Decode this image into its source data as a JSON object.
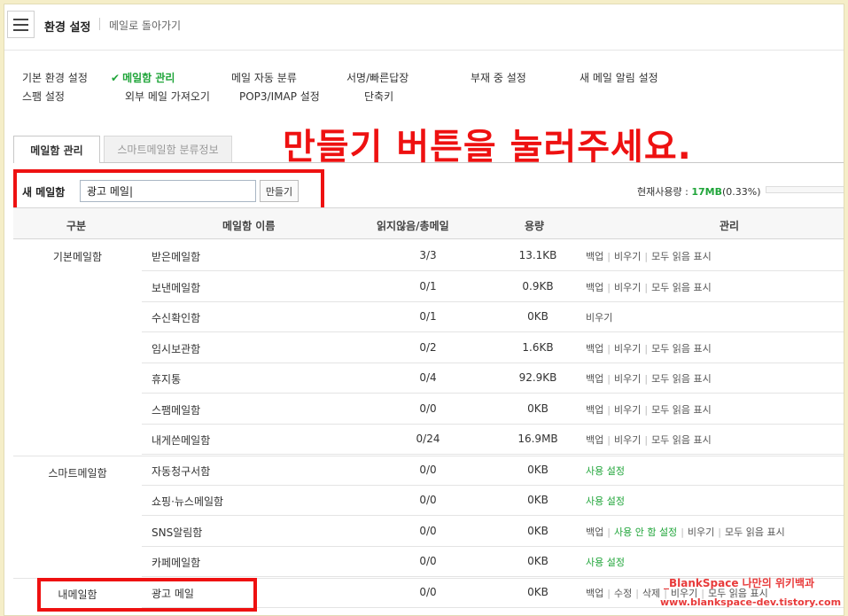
{
  "header": {
    "title": "환경 설정",
    "back_link": "메일로 돌아가기"
  },
  "settings_nav": {
    "basic": "기본 환경 설정",
    "mailbox": "메일함 관리",
    "auto_sort": "메일 자동 분류",
    "signature": "서명/빠른답장",
    "away": "부재 중 설정",
    "new_mail_alert": "새 메일 알림 설정",
    "spam": "스팸 설정",
    "external": "외부 메일 가져오기",
    "pop3": "POP3/IMAP 설정",
    "shortcut": "단축키"
  },
  "tabs": {
    "tab1": "메일함 관리",
    "tab2": "스마트메일함 분류정보"
  },
  "instruction": "만들기 버튼을 눌러주세요.",
  "new_mailbox": {
    "label": "새 메일함",
    "input_value": "광고 메일|",
    "button": "만들기"
  },
  "usage": {
    "label": "현재사용량 : ",
    "value": "17MB",
    "percent": "(0.33%)"
  },
  "table": {
    "headers": {
      "category": "구분",
      "name": "메일함 이름",
      "unread": "읽지않음/총메일",
      "size": "용량",
      "manage": "관리"
    },
    "groups": {
      "basic": "기본메일함",
      "smart": "스마트메일함",
      "mine": "내메일함"
    },
    "rows": [
      {
        "name": "받은메일함",
        "count": "3/3",
        "size": "13.1KB",
        "actions": [
          "백업",
          "비우기",
          "모두 읽음 표시"
        ]
      },
      {
        "name": "보낸메일함",
        "count": "0/1",
        "size": "0.9KB",
        "actions": [
          "백업",
          "비우기",
          "모두 읽음 표시"
        ]
      },
      {
        "name": "수신확인함",
        "count": "0/1",
        "size": "0KB",
        "actions": [
          "비우기"
        ]
      },
      {
        "name": "임시보관함",
        "count": "0/2",
        "size": "1.6KB",
        "actions": [
          "백업",
          "비우기",
          "모두 읽음 표시"
        ]
      },
      {
        "name": "휴지통",
        "count": "0/4",
        "size": "92.9KB",
        "actions": [
          "백업",
          "비우기",
          "모두 읽음 표시"
        ]
      },
      {
        "name": "스팸메일함",
        "count": "0/0",
        "size": "0KB",
        "actions": [
          "백업",
          "비우기",
          "모두 읽음 표시"
        ]
      },
      {
        "name": "내게쓴메일함",
        "count": "0/24",
        "size": "16.9MB",
        "actions": [
          "백업",
          "비우기",
          "모두 읽음 표시"
        ]
      },
      {
        "name": "자동청구서함",
        "count": "0/0",
        "size": "0KB",
        "actions": [
          "사용 설정"
        ]
      },
      {
        "name": "쇼핑·뉴스메일함",
        "count": "0/0",
        "size": "0KB",
        "actions": [
          "사용 설정"
        ]
      },
      {
        "name": "SNS알림함",
        "count": "0/0",
        "size": "0KB",
        "actions": [
          "백업",
          "사용 안 함 설정",
          "비우기",
          "모두 읽음 표시"
        ]
      },
      {
        "name": "카페메일함",
        "count": "0/0",
        "size": "0KB",
        "actions": [
          "사용 설정"
        ]
      },
      {
        "name": "광고 메일",
        "count": "0/0",
        "size": "0KB",
        "actions": [
          "백업",
          "수정",
          "삭제",
          "비우기",
          "모두 읽음 표시"
        ]
      }
    ]
  },
  "watermark": {
    "line1": "_BlankSpace 나만의 위키백과",
    "line2": "www.blankspace-dev.tistory.com"
  },
  "colors": {
    "accent_green": "#20a53a",
    "highlight_red": "#ee1111",
    "background": "#f5eec8"
  }
}
